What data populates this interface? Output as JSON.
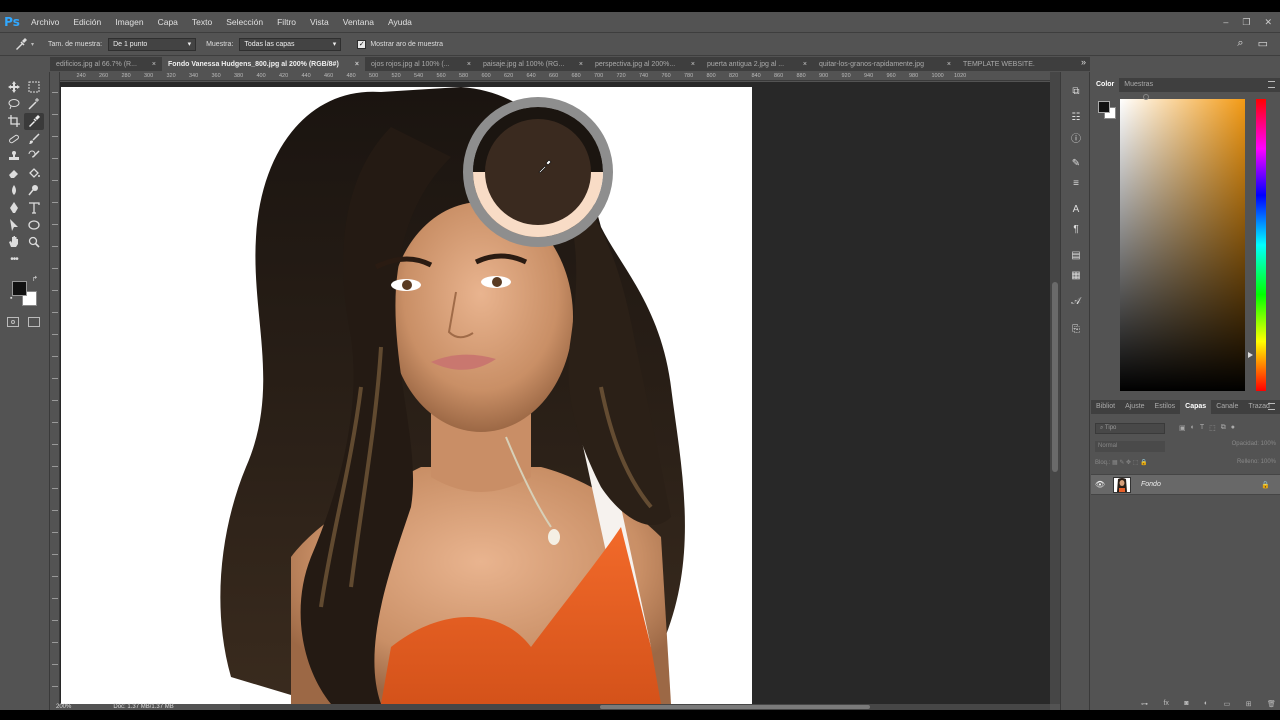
{
  "app": {
    "logo": "Ps"
  },
  "menu": [
    "Archivo",
    "Edición",
    "Imagen",
    "Capa",
    "Texto",
    "Selección",
    "Filtro",
    "Vista",
    "Ventana",
    "Ayuda"
  ],
  "window_controls": [
    "–",
    "❐",
    "✕"
  ],
  "options": {
    "sample_size_label": "Tam. de muestra:",
    "sample_size_value": "De 1 punto",
    "sample_label": "Muestra:",
    "sample_value": "Todas las capas",
    "ring_checked": "✓",
    "ring_label": "Mostrar aro de muestra"
  },
  "tabs": [
    {
      "label": "edificios.jpg al 66.7% (R...",
      "active": false
    },
    {
      "label": "Fondo Vanessa Hudgens_800.jpg al 200% (RGB/8#)",
      "active": true
    },
    {
      "label": "ojos rojos.jpg al 100% (...",
      "active": false
    },
    {
      "label": "paisaje.jpg al 100% (RG...",
      "active": false
    },
    {
      "label": "perspectiva.jpg al 200%...",
      "active": false
    },
    {
      "label": "puerta antigua 2.jpg al ...",
      "active": false
    },
    {
      "label": "quitar-los-granos-rapidamente.jpg",
      "active": false
    },
    {
      "label": "TEMPLATE WEBSITE.",
      "active": false
    }
  ],
  "tabs_more": "»",
  "tab_close": "×",
  "ruler_ticks": [
    "220",
    "240",
    "260",
    "280",
    "300",
    "320",
    "340",
    "360",
    "380",
    "400",
    "420",
    "440",
    "460",
    "480",
    "500",
    "520",
    "540",
    "560",
    "580",
    "600",
    "620",
    "640",
    "660",
    "680",
    "700",
    "720",
    "740",
    "760",
    "780",
    "800",
    "820",
    "840",
    "860",
    "880",
    "900",
    "920",
    "940",
    "960",
    "980",
    "1000",
    "1020"
  ],
  "status": {
    "zoom": "200%",
    "doc": "Doc: 1.37 MB/1.37 MB"
  },
  "color_panel": {
    "tabs": [
      "Color",
      "Muestras"
    ],
    "active": "Color",
    "hue_color": "#f39a14"
  },
  "layers_panel": {
    "tabs": [
      "Bibliot",
      "Ajuste",
      "Estilos",
      "Capas",
      "Canale",
      "Trazad"
    ],
    "active": "Capas",
    "search_placeholder": "Tipo",
    "blend_mode": "Normal",
    "opacity_label": "Opacidad:",
    "opacity_value": "100%",
    "lock_label": "Bloq.:",
    "fill_label": "Relleno:",
    "fill_value": "100%",
    "layers": [
      {
        "name": "Fondo",
        "visible": true,
        "locked": true
      }
    ]
  },
  "sampler_ring": {
    "top_color": "#1b1510",
    "bottom_color": "#f8dcc6"
  }
}
